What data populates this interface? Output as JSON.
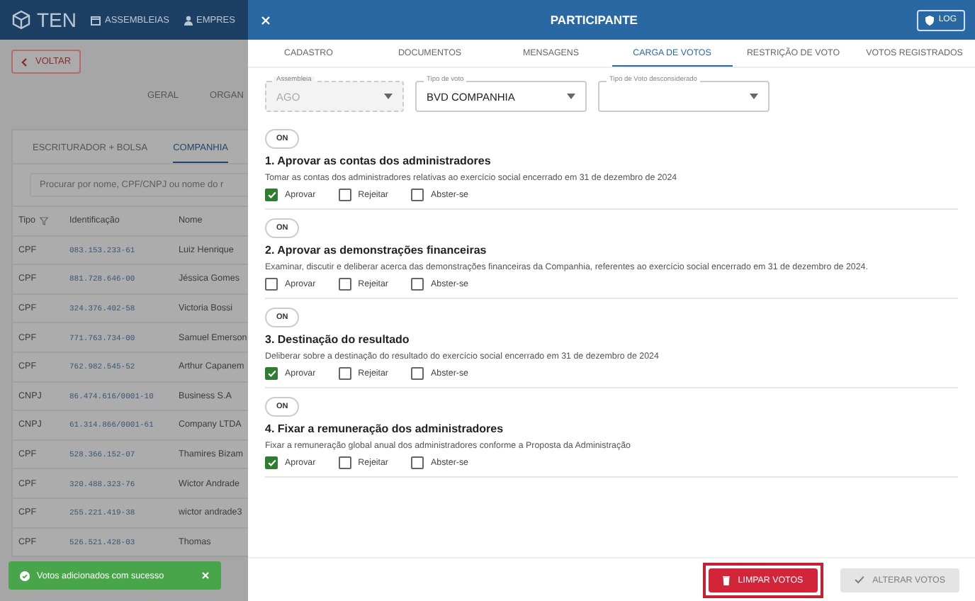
{
  "background": {
    "logo": "TEN",
    "nav": [
      {
        "label": "ASSEMBLEIAS"
      },
      {
        "label": "EMPRES"
      }
    ],
    "back_button": "VOLTAR",
    "page_tabs": [
      {
        "label": "GERAL",
        "selected": false
      },
      {
        "label": "ORGAN",
        "selected": false
      }
    ],
    "list_tabs": [
      {
        "label": "ESCRITURADOR + BOLSA",
        "selected": false
      },
      {
        "label": "COMPANHIA",
        "selected": true
      }
    ],
    "search": {
      "placeholder": "Procurar por nome, CPF/CNPJ ou nome do r"
    },
    "table": {
      "columns": [
        "Tipo",
        "Identificação",
        "Nome"
      ],
      "rows": [
        {
          "tipo": "CPF",
          "id": "083.153.233-61",
          "nome": "Luiz Henrique"
        },
        {
          "tipo": "CPF",
          "id": "881.728.646-00",
          "nome": "Jéssica Gomes"
        },
        {
          "tipo": "CPF",
          "id": "324.376.402-58",
          "nome": "Victoria Bossi"
        },
        {
          "tipo": "CPF",
          "id": "771.763.734-00",
          "nome": "Samuel Emerson"
        },
        {
          "tipo": "CPF",
          "id": "762.982.545-52",
          "nome": "Arthur Capanem"
        },
        {
          "tipo": "CNPJ",
          "id": "86.474.616/0001-10",
          "nome": "Business S.A"
        },
        {
          "tipo": "CNPJ",
          "id": "61.314.866/0001-61",
          "nome": "Company LTDA"
        },
        {
          "tipo": "CPF",
          "id": "528.366.152-07",
          "nome": "Thamires Bizam"
        },
        {
          "tipo": "CPF",
          "id": "320.488.323-76",
          "nome": "Wictor Andrade"
        },
        {
          "tipo": "CPF",
          "id": "255.221.419-38",
          "nome": "wictor andrade3"
        },
        {
          "tipo": "CPF",
          "id": "526.521.428-03",
          "nome": "Thomas"
        }
      ]
    },
    "toast": {
      "message": "Votos adicionados com sucesso"
    }
  },
  "drawer": {
    "title": "PARTICIPANTE",
    "log_button": "LOG",
    "tabs": [
      {
        "label": "CADASTRO",
        "selected": false
      },
      {
        "label": "DOCUMENTOS",
        "selected": false
      },
      {
        "label": "MENSAGENS",
        "selected": false
      },
      {
        "label": "CARGA DE VOTOS",
        "selected": true
      },
      {
        "label": "RESTRIÇÃO DE VOTO",
        "selected": false
      },
      {
        "label": "VOTOS REGISTRADOS",
        "selected": false
      }
    ],
    "fields": [
      {
        "label": "Assembleia",
        "value": "AGO",
        "disabled": true
      },
      {
        "label": "Tipo de voto",
        "value": "BVD COMPANHIA",
        "disabled": false
      },
      {
        "label": "Tipo de Voto desconsiderado",
        "disabled": false
      }
    ],
    "resolutions": [
      {
        "toggle": "ON",
        "title": "1. Aprovar as contas dos administradores",
        "description": "Tomar as contas dos administradores relativas ao exercício social encerrado em 31 de dezembro de 2024",
        "options": [
          {
            "label": "Aprovar",
            "checked": true
          },
          {
            "label": "Rejeitar",
            "checked": false
          },
          {
            "label": "Abster-se",
            "checked": false
          }
        ]
      },
      {
        "toggle": "ON",
        "title": "2. Aprovar as demonstrações financeiras",
        "description": "Examinar, discutir e deliberar acerca das demonstrações financeiras da Companhia, referentes ao exercício social encerrado em 31 de dezembro de 2024.",
        "options": [
          {
            "label": "Aprovar",
            "checked": false
          },
          {
            "label": "Rejeitar",
            "checked": false
          },
          {
            "label": "Abster-se",
            "checked": false
          }
        ]
      },
      {
        "toggle": "ON",
        "title": "3. Destinação do resultado",
        "description": "Deliberar sobre a destinação do resultado do exercício social encerrado em 31 de dezembro de 2024",
        "options": [
          {
            "label": "Aprovar",
            "checked": true
          },
          {
            "label": "Rejeitar",
            "checked": false
          },
          {
            "label": "Abster-se",
            "checked": false
          }
        ]
      },
      {
        "toggle": "ON",
        "title": "4. Fixar a remuneração dos administradores",
        "description": "Fixar a remuneração global anual dos administradores conforme a Proposta da Administração",
        "options": [
          {
            "label": "Aprovar",
            "checked": true
          },
          {
            "label": "Rejeitar",
            "checked": false
          },
          {
            "label": "Abster-se",
            "checked": false
          }
        ]
      }
    ],
    "buttons": [
      {
        "label": "LIMPAR VOTOS",
        "kind": "danger",
        "disabled": false,
        "highlighted": true
      },
      {
        "label": "ALTERAR VOTOS",
        "kind": "confirm",
        "disabled": true,
        "highlighted": false
      }
    ]
  }
}
